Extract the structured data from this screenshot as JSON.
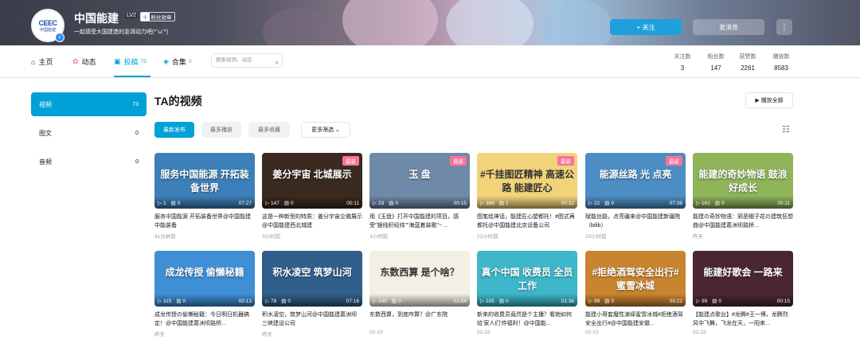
{
  "header": {
    "username": "中国能建",
    "level": "LV2",
    "fan_badge": "粉丝勋章",
    "fan_badge_icon": "十",
    "signature": "一起感受大国建造的澎湃动力吧(*ˆωˆ*)",
    "avatar_logo": "CEEC",
    "avatar_sub": "中国能建",
    "follow_label": "+ 关注",
    "message_label": "发消息",
    "more_label": "⋮"
  },
  "nav": {
    "tabs": [
      {
        "label": "主页",
        "count": "",
        "icon": "home-icon"
      },
      {
        "label": "动态",
        "count": "",
        "icon": "dynamic-icon"
      },
      {
        "label": "投稿",
        "count": "73",
        "icon": "upload-icon"
      },
      {
        "label": "合集",
        "count": "8",
        "icon": "collection-icon"
      }
    ],
    "search_placeholder": "搜索视频、动态",
    "stats": [
      {
        "label": "关注数",
        "value": "3"
      },
      {
        "label": "粉丝数",
        "value": "147"
      },
      {
        "label": "获赞数",
        "value": "2261"
      },
      {
        "label": "播放数",
        "value": "8583"
      }
    ]
  },
  "sidebar": {
    "items": [
      {
        "label": "视频",
        "count": "73"
      },
      {
        "label": "图文",
        "count": "0"
      },
      {
        "label": "音频",
        "count": "0"
      }
    ]
  },
  "main": {
    "heading": "TA的视频",
    "play_all": "▶ 播放全部",
    "filters": [
      "最新发布",
      "最多播放",
      "最多收藏"
    ],
    "more_filter": "更多筛选 ⌄"
  },
  "videos": [
    {
      "thumb_text": "服务中国能源 开拓装备世界",
      "new": "",
      "plays": "1",
      "comments": "0",
      "duration": "07:27",
      "title": "服务中国能源 开拓装备世界@中国能建中能装备",
      "date": "41分钟前",
      "bg": "#3d7fb8"
    },
    {
      "thumb_text": "姜分宇宙 北城展示",
      "new": "最新",
      "plays": "147",
      "comments": "0",
      "duration": "00:11",
      "title": "这是一种新型的特质：姜分宇宙企微展示@中国能建西北城建",
      "date": "3小时前",
      "bg": "#3a2a1f"
    },
    {
      "thumb_text": "玉 盘",
      "new": "最新",
      "plays": "23",
      "comments": "0",
      "duration": "00:15",
      "title": "用《玉盘》打开中国能建的项目，感受\"银线织经纬\"\"海蓝着装歌\"~ ...",
      "date": "3小时前",
      "bg": "#6f89a8"
    },
    {
      "thumb_text": "#千挂图匠精神 高速公路 能建匠心",
      "new": "最新",
      "plays": "388",
      "comments": "1",
      "duration": "00:32",
      "title": "图笔绘神话，能建匠心塑都托！#图式再都托@中国能建北京设备公司",
      "date": "22小时前",
      "bg": "#f1d37a"
    },
    {
      "thumb_text": "能源丝路 光 点亮",
      "new": "最新",
      "plays": "22",
      "comments": "0",
      "duration": "07:38",
      "title": "赋能丝路，点亮疆来@中国能建新疆院（bilib）",
      "date": "23小时前",
      "bg": "#4c8dc4"
    },
    {
      "thumb_text": "能建的奇妙物语 鼓浪好成长",
      "new": "",
      "plays": "161",
      "comments": "0",
      "duration": "00:11",
      "title": "能建の奇妙物语：邪恶帽子花の建筑狂想曲@中国能建葛洲坝路桥...",
      "date": "昨天",
      "bg": "#8fb45a"
    },
    {
      "thumb_text": "成龙传授 偷懒秘籍",
      "new": "",
      "plays": "115",
      "comments": "0",
      "duration": "00:13",
      "title": "成龙传授の偷懒秘籍：今日明日机器搞定！@中国能建葛洲坝路桥...",
      "date": "昨天",
      "bg": "#3f8fd6"
    },
    {
      "thumb_text": "积水凌空 筑梦山河",
      "new": "",
      "plays": "78",
      "comments": "0",
      "duration": "07:16",
      "title": "积水凌空，筑梦山河@中国能建葛洲坝三峡建设公司",
      "date": "昨天",
      "bg": "#2f5f8a"
    },
    {
      "thumb_text": "东数西算 是个啥？",
      "new": "",
      "plays": "140",
      "comments": "0",
      "duration": "01:54",
      "title": "东数西算，到底咋算？@广东院",
      "date": "02-23",
      "bg": "#f3efe4"
    },
    {
      "thumb_text": "真个中国 收费员 全员工作",
      "new": "",
      "plays": "105",
      "comments": "0",
      "duration": "01:36",
      "title": "新来的收费员竟然是个主播？看她如何给'家人们'炸福利！@中国能...",
      "date": "02-23",
      "bg": "#3db7c9"
    },
    {
      "thumb_text": "#拒绝酒驾安全出行# 蜜雪冰城",
      "new": "",
      "plays": "99",
      "comments": "0",
      "duration": "00:22",
      "title": "能建小哥套魔性演绎蜜雪冰城#拒绝酒驾安全出行#@中国能建安徽...",
      "date": "02-23",
      "bg": "#c9842f"
    },
    {
      "thumb_text": "能建好歌会 一路来",
      "new": "",
      "plays": "99",
      "comments": "0",
      "duration": "00:15",
      "title": "【能建点歌台】#龙腾#王一博，龙腾烈风中飞舞，飞龙在天，一阳来...",
      "date": "02-23",
      "bg": "#4a2730"
    }
  ]
}
